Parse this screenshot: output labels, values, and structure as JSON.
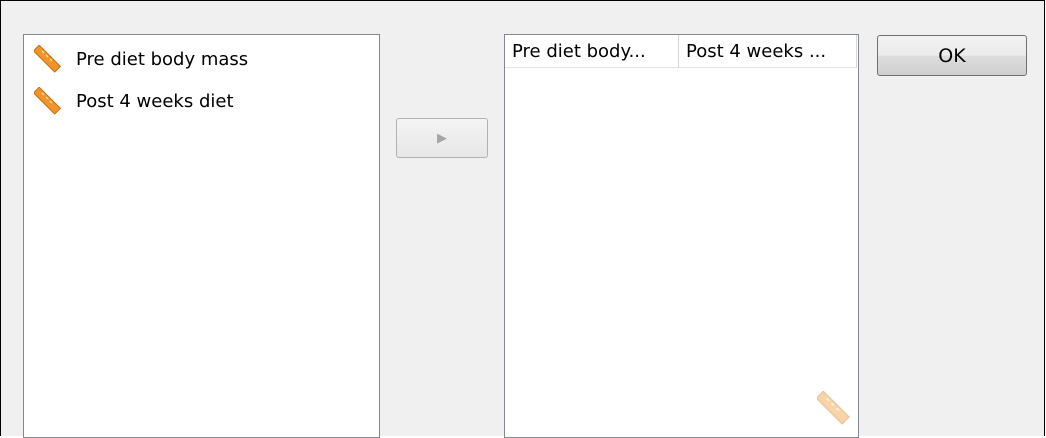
{
  "source_list": {
    "items": [
      {
        "label": "Pre diet body mass",
        "icon": "ruler-icon"
      },
      {
        "label": "Post 4 weeks diet",
        "icon": "ruler-icon"
      }
    ]
  },
  "move_button": {
    "symbol": "▶",
    "icon": "right-arrow-icon"
  },
  "target_grid": {
    "columns": [
      {
        "label": "Pre diet body..."
      },
      {
        "label": "Post 4 weeks ..."
      }
    ],
    "watermark_icon": "ruler-icon"
  },
  "ok_button": {
    "label": "OK"
  },
  "colors": {
    "ruler_orange": "#f0952a",
    "ruler_stripe": "#f7c27a"
  }
}
